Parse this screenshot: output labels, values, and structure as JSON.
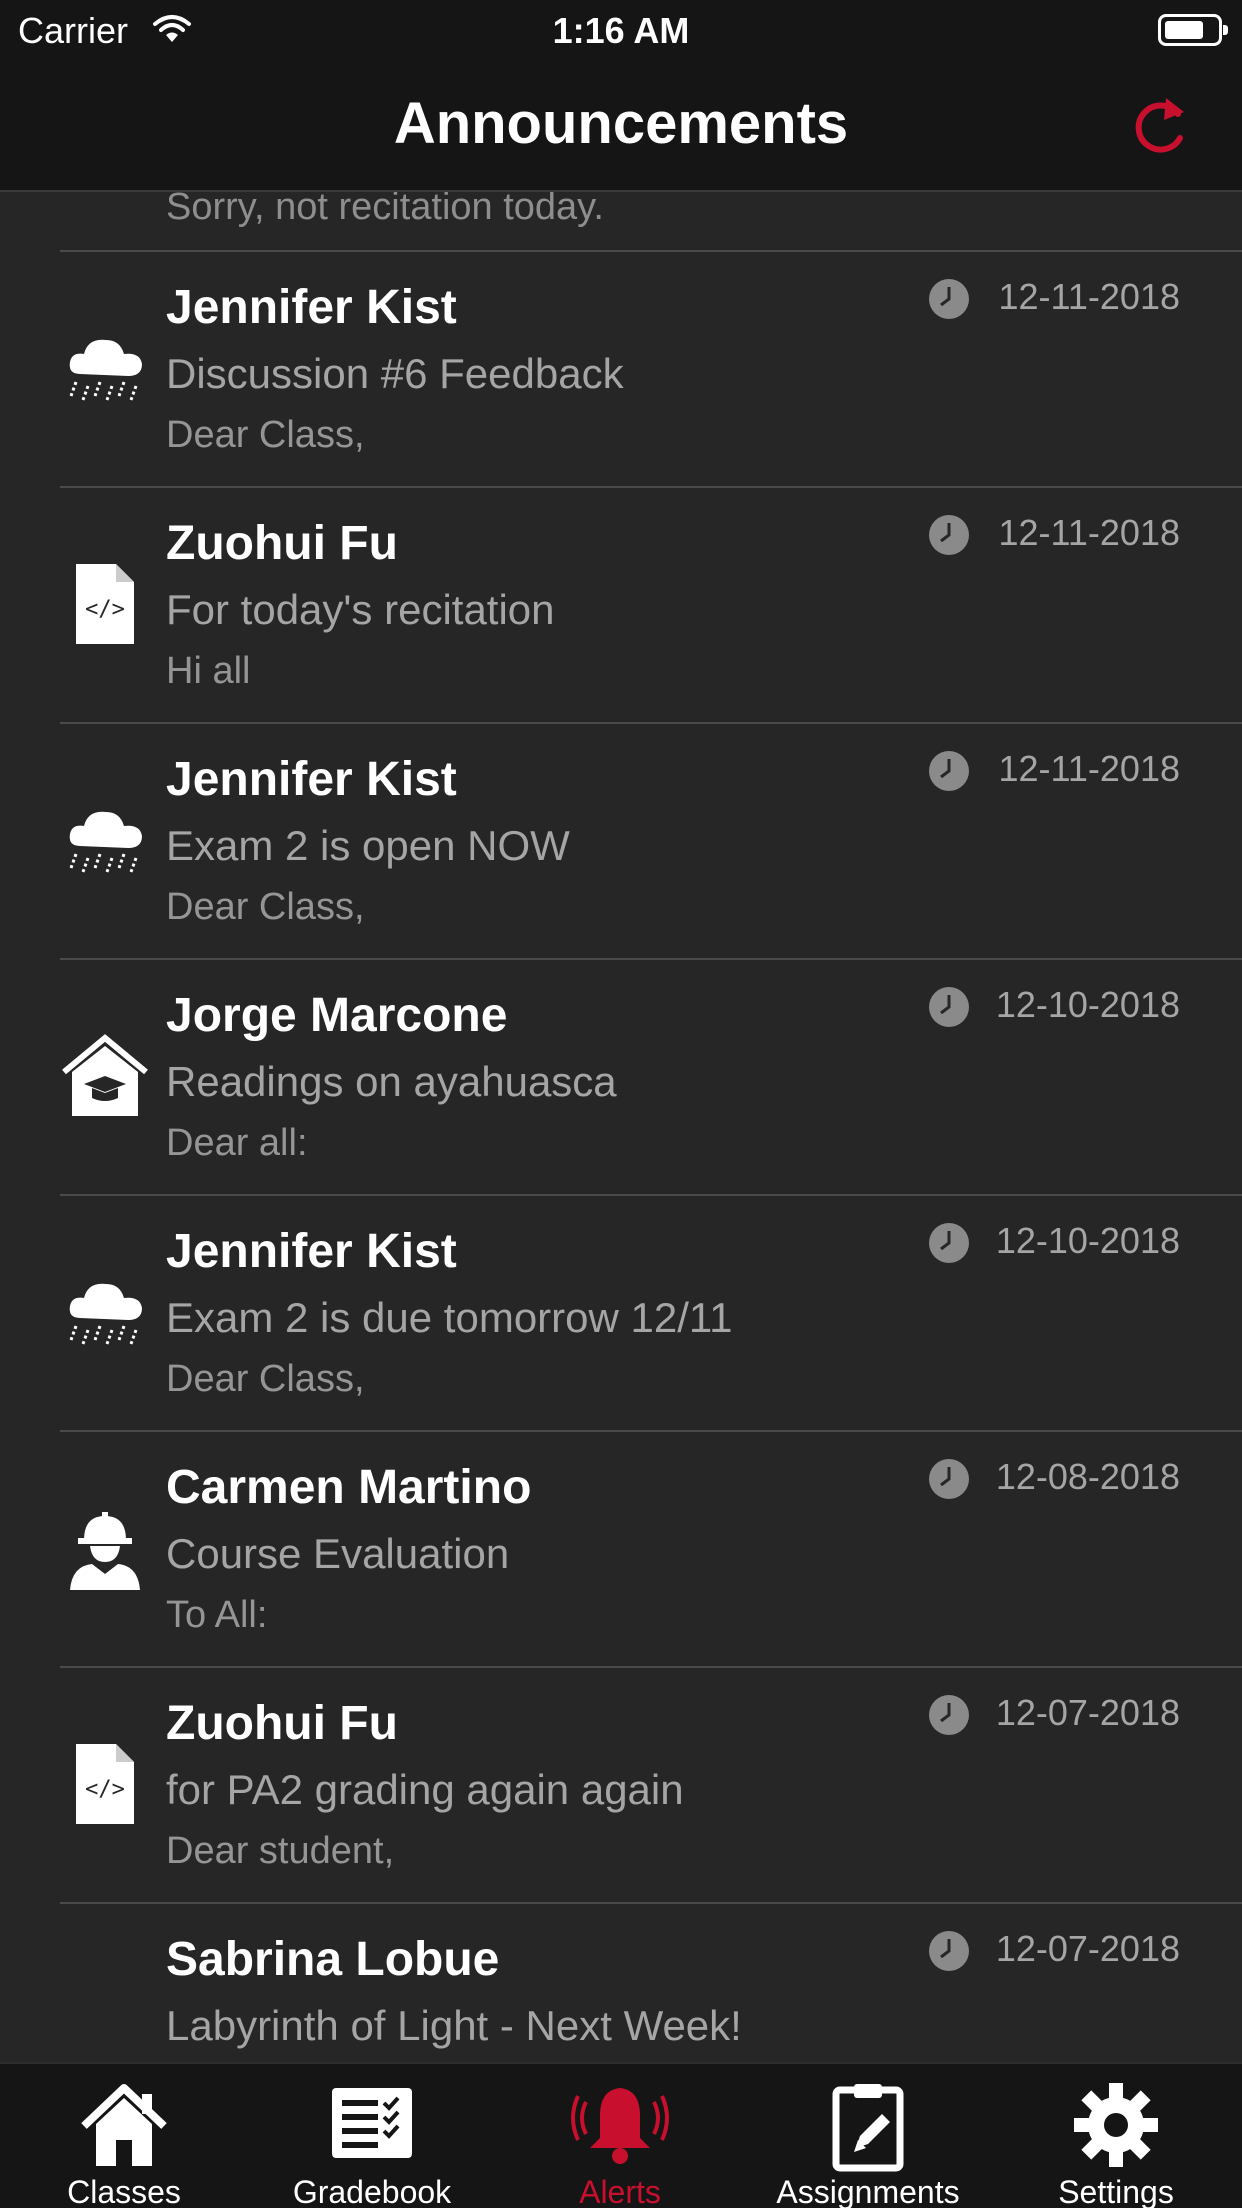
{
  "status_bar": {
    "carrier": "Carrier",
    "time": "1:16 AM"
  },
  "nav": {
    "title": "Announcements",
    "refresh_icon": "refresh-icon"
  },
  "colors": {
    "accent": "#c8102e",
    "background": "#262627",
    "bar": "#151515"
  },
  "partial_top_preview": "Sorry, not recitation today.",
  "announcements": [
    {
      "author": "Jennifer Kist",
      "subject": "Discussion #6 Feedback",
      "preview": "Dear Class,",
      "date": "12-11-2018",
      "icon": "rain-cloud-icon"
    },
    {
      "author": "Zuohui Fu",
      "subject": "For today's recitation",
      "preview": "Hi all",
      "date": "12-11-2018",
      "icon": "code-file-icon"
    },
    {
      "author": "Jennifer Kist",
      "subject": "Exam 2 is open NOW",
      "preview": "Dear Class,",
      "date": "12-11-2018",
      "icon": "rain-cloud-icon"
    },
    {
      "author": "Jorge Marcone",
      "subject": "Readings on ayahuasca",
      "preview": "Dear all:",
      "date": "12-10-2018",
      "icon": "graduation-house-icon"
    },
    {
      "author": "Jennifer Kist",
      "subject": "Exam 2 is due tomorrow 12/11",
      "preview": "Dear Class,",
      "date": "12-10-2018",
      "icon": "rain-cloud-icon"
    },
    {
      "author": "Carmen Martino",
      "subject": "Course Evaluation",
      "preview": "To All:",
      "date": "12-08-2018",
      "icon": "construction-worker-icon"
    },
    {
      "author": "Zuohui Fu",
      "subject": "for PA2 grading again again",
      "preview": "Dear student,",
      "date": "12-07-2018",
      "icon": "code-file-icon"
    },
    {
      "author": "Sabrina Lobue",
      "subject": "Labyrinth of Light - Next Week!",
      "preview": "",
      "date": "12-07-2018",
      "icon": ""
    }
  ],
  "tabs": [
    {
      "label": "Classes",
      "icon": "house-icon",
      "active": false
    },
    {
      "label": "Gradebook",
      "icon": "gradebook-icon",
      "active": false
    },
    {
      "label": "Alerts",
      "icon": "bell-icon",
      "active": true
    },
    {
      "label": "Assignments",
      "icon": "assignment-icon",
      "active": false
    },
    {
      "label": "Settings",
      "icon": "gear-icon",
      "active": false
    }
  ]
}
